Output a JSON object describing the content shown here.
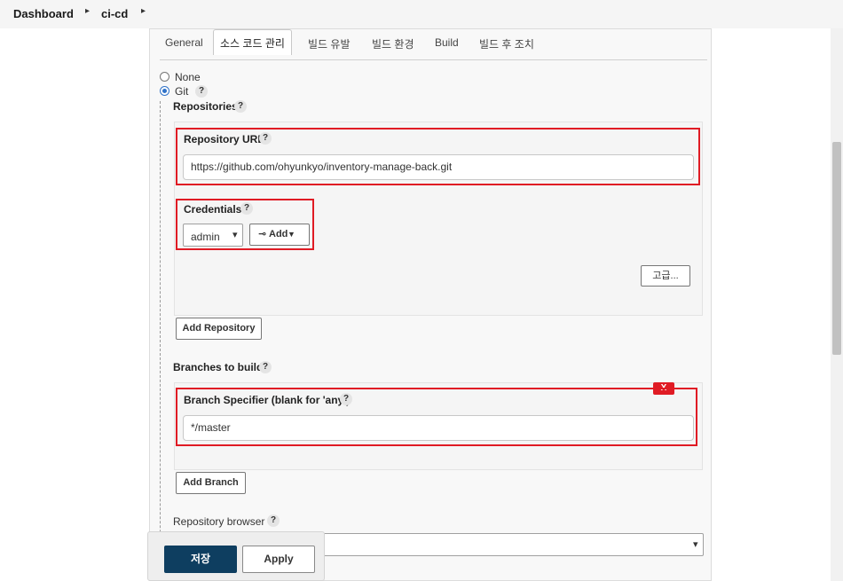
{
  "breadcrumb": {
    "dashboard": "Dashboard",
    "job": "ci-cd",
    "separator": "▸"
  },
  "tabs": [
    {
      "label": "General",
      "active": false
    },
    {
      "label": "소스 코드 관리",
      "active": true
    },
    {
      "label": "빌드 유발",
      "active": false
    },
    {
      "label": "빌드 환경",
      "active": false
    },
    {
      "label": "Build",
      "active": false
    },
    {
      "label": "빌드 후 조치",
      "active": false
    }
  ],
  "scm": {
    "options": [
      {
        "label": "None",
        "selected": false
      },
      {
        "label": "Git",
        "selected": true
      }
    ],
    "repositories_label": "Repositories",
    "repo_url_label": "Repository URL",
    "repo_url_value": "https://github.com/ohyunkyo/inventory-manage-back.git",
    "credentials_label": "Credentials",
    "credentials_selected": "admin",
    "add_credentials_label": "Add",
    "advanced_label": "고급...",
    "add_repository_label": "Add Repository",
    "branches_label": "Branches to build",
    "branch_specifier_label": "Branch Specifier (blank for 'any')",
    "branch_specifier_value": "*/master",
    "delete_branch_label": "X",
    "add_branch_label": "Add Branch",
    "repo_browser_label": "Repository browser"
  },
  "help_glyph": "?",
  "chevron_glyph": "▾",
  "save_label": "저장",
  "apply_label": "Apply",
  "colors": {
    "highlight_red": "#e01b24",
    "save_button": "#0e3e60",
    "radio_selected": "#2f72c8"
  }
}
